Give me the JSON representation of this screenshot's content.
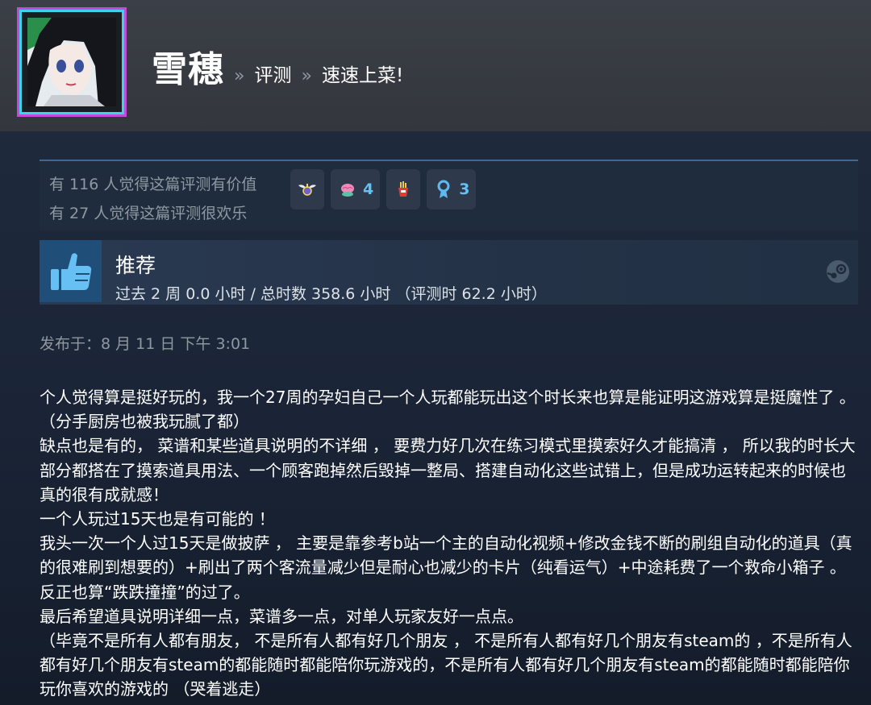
{
  "header": {
    "user_name": "雪穗",
    "breadcrumb_sep": "»",
    "crumb_review": "评测",
    "crumb_game": "速速上菜!"
  },
  "votes": {
    "helpful": "有 116 人觉得这篇评测有价值",
    "funny": "有 27 人觉得这篇评测很欢乐",
    "awards": [
      {
        "icon": "winged-medal-icon",
        "count": ""
      },
      {
        "icon": "brain-icon",
        "count": "4"
      },
      {
        "icon": "fries-icon",
        "count": ""
      },
      {
        "icon": "ribbon-award-icon",
        "count": "3"
      }
    ]
  },
  "recommendation": {
    "label": "推荐",
    "hours": "过去 2 周 0.0 小时 / 总时数 358.6 小时 （评测时 62.2 小时）",
    "icon": "thumbs-up-icon",
    "platform_icon": "steam-icon"
  },
  "posted": "发布于：8 月 11 日 下午 3:01",
  "review": {
    "paragraphs": [
      "个人觉得算是挺好玩的，我一个27周的孕妇自己一个人玩都能玩出这个时长来也算是能证明这游戏算是挺魔性了 。（分手厨房也被我玩腻了都）",
      "缺点也是有的， 菜谱和某些道具说明的不详细 ， 要费力好几次在练习模式里摸索好久才能搞清 ， 所以我的时长大部分都搭在了摸索道具用法、一个顾客跑掉然后毁掉一整局、搭建自动化这些试错上，但是成功运转起来的时候也真的很有成就感！",
      "一个人玩过15天也是有可能的 ！",
      "我头一次一个人过15天是做披萨 ， 主要是靠参考b站一个主的自动化视频+修改金钱不断的刷组自动化的道具（真的很难刷到想要的）+刷出了两个客流量减少但是耐心也减少的卡片（纯看运气）+中途耗费了一个救命小箱子 。反正也算“跌跌撞撞”的过了。",
      "最后希望道具说明详细一点，菜谱多一点，对单人玩家友好一点点。",
      "（毕竟不是所有人都有朋友， 不是所有人都有好几个朋友 ， 不是所有人都有好几个朋友有steam的 ，不是所有人都有好几个朋友有steam的都能随时都能陪你玩游戏的，不是所有人都有好几个朋友有steam的都能随时都能陪你玩你喜欢的游戏的 （哭着逃走）"
    ]
  },
  "colors": {
    "header_bg": "#3b3f46",
    "content_bg": "#1b2638",
    "accent_blue": "#66c0f4",
    "muted_text": "#8f98a0",
    "avatar_border_pink": "#c54ad8",
    "avatar_border_cyan": "#3fd3e8"
  }
}
